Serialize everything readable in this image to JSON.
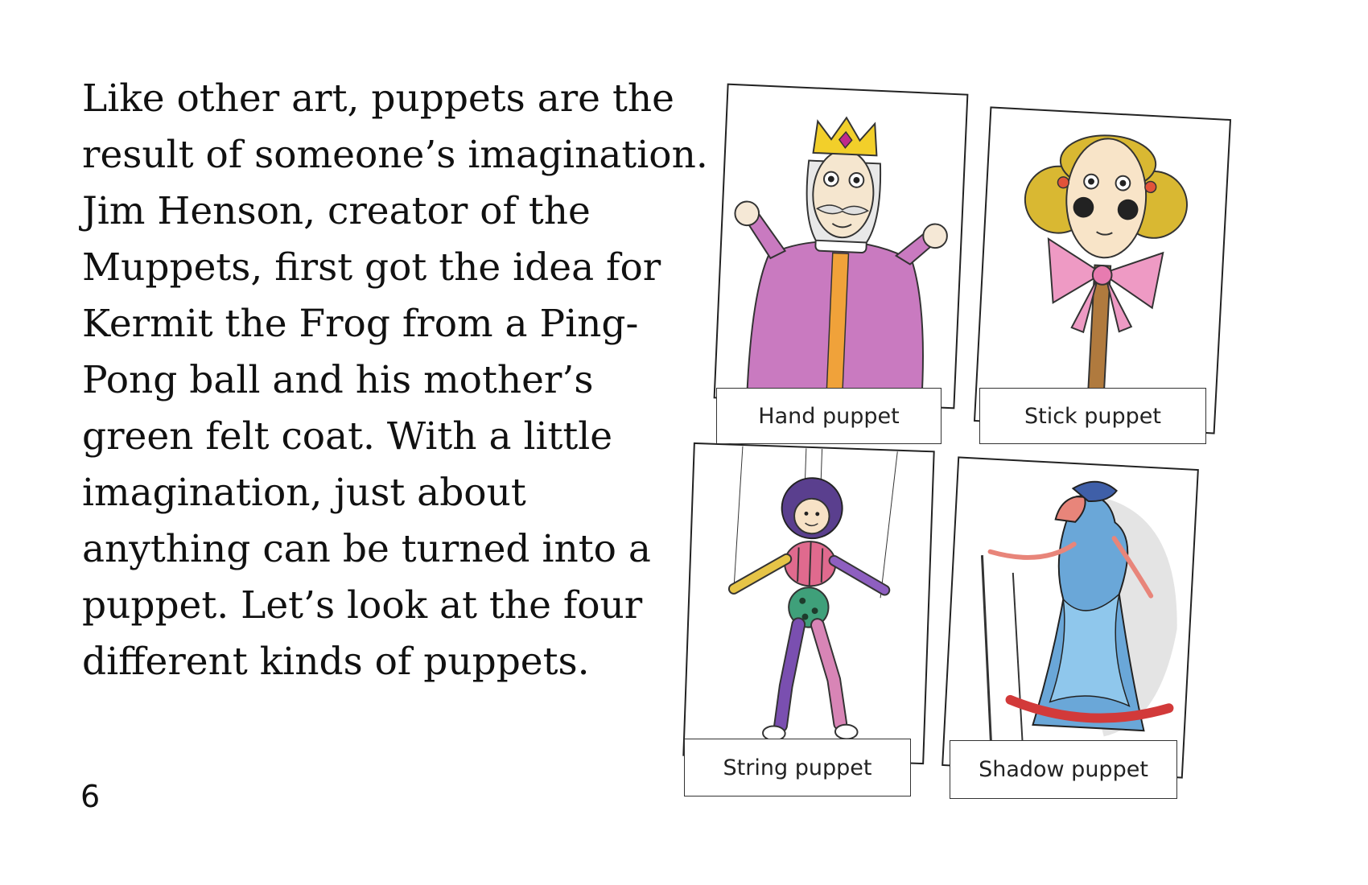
{
  "text_lines": [
    "Like other art, puppets are the",
    "result of someone’s imagination.",
    "Jim Henson, creator of the",
    "Muppets, first got the idea for",
    "Kermit the Frog from a Ping-",
    "Pong ball and his mother’s",
    "green felt coat. With a little",
    "imagination, just about",
    "anything can be turned into a",
    "puppet. Let’s look at the four",
    "different kinds of puppets."
  ],
  "page_number": "6",
  "captions": {
    "hand": "Hand puppet",
    "stick": "Stick puppet",
    "string": "String puppet",
    "shadow": "Shadow puppet"
  },
  "colors": {
    "robe": "#c97ac0",
    "crown": "#f2cf2a",
    "hair": "#d9b832",
    "bow": "#ee9ac4",
    "stick": "#b07a3e",
    "shadow_blue": "#6aa7d8",
    "shadow_red": "#d23a3a"
  }
}
